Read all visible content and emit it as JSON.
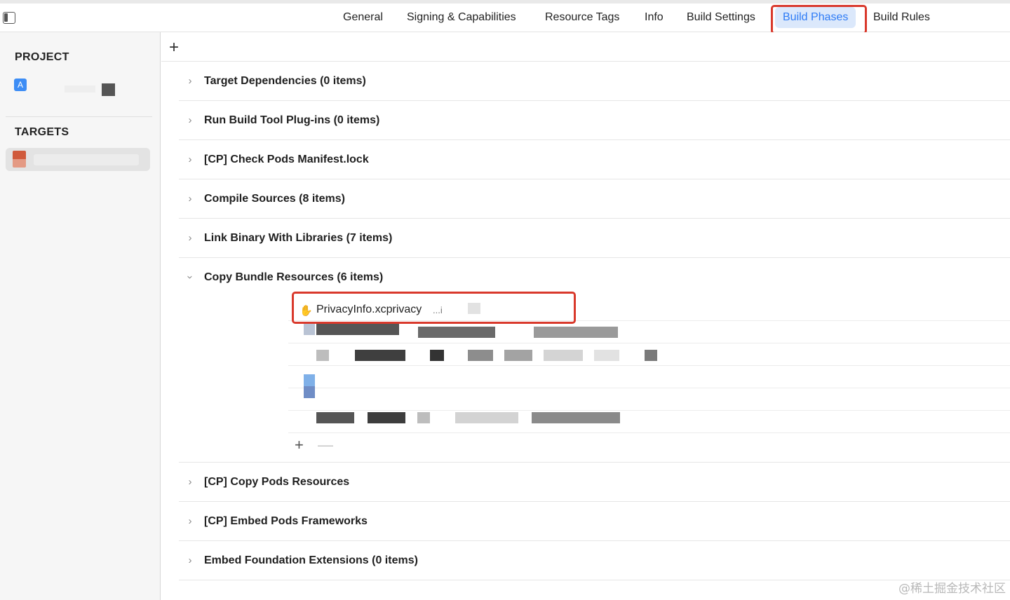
{
  "tabs": [
    "General",
    "Signing & Capabilities",
    "Resource Tags",
    "Info",
    "Build Settings",
    "Build Phases",
    "Build Rules"
  ],
  "active_tab": "Build Phases",
  "sidebar": {
    "project_header": "PROJECT",
    "targets_header": "TARGETS"
  },
  "toolbar": {
    "add_label": "+"
  },
  "phases": [
    {
      "title": "Target Dependencies (0 items)",
      "expanded": false
    },
    {
      "title": "Run Build Tool Plug-ins (0 items)",
      "expanded": false
    },
    {
      "title": "[CP] Check Pods Manifest.lock",
      "expanded": false
    },
    {
      "title": "Compile Sources (8 items)",
      "expanded": false
    },
    {
      "title": "Link Binary With Libraries (7 items)",
      "expanded": false
    },
    {
      "title": "Copy Bundle Resources (6 items)",
      "expanded": true
    },
    {
      "title": "[CP] Copy Pods Resources",
      "expanded": false
    },
    {
      "title": "[CP] Embed Pods Frameworks",
      "expanded": false
    },
    {
      "title": "Embed Foundation Extensions (0 items)",
      "expanded": false
    }
  ],
  "bundle_resources": {
    "first_file": {
      "name": "PrivacyInfo.xcprivacy",
      "path": "...i"
    },
    "add_label": "+",
    "remove_label": "—"
  },
  "watermark": "@稀土掘金技术社区",
  "colors": {
    "accent": "#2f7cf6",
    "highlight": "#d9392c",
    "active_tab_bg": "#dbe8fb"
  }
}
